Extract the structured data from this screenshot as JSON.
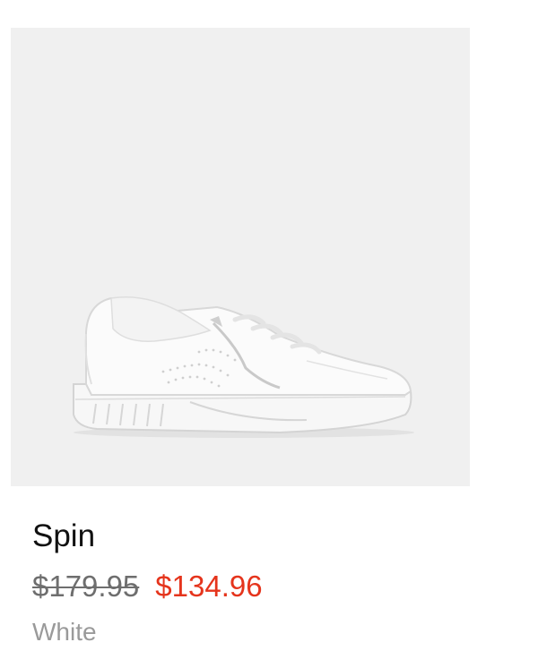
{
  "product": {
    "name": "Spin",
    "original_price": "$179.95",
    "sale_price": "$134.96",
    "color": "White",
    "image_alt": "white leather sneaker with side zip"
  },
  "colors": {
    "image_bg": "#f0f0f0",
    "sale": "#e5341c",
    "original_price": "#6e6e6e",
    "color_label": "#9a9a9a"
  }
}
